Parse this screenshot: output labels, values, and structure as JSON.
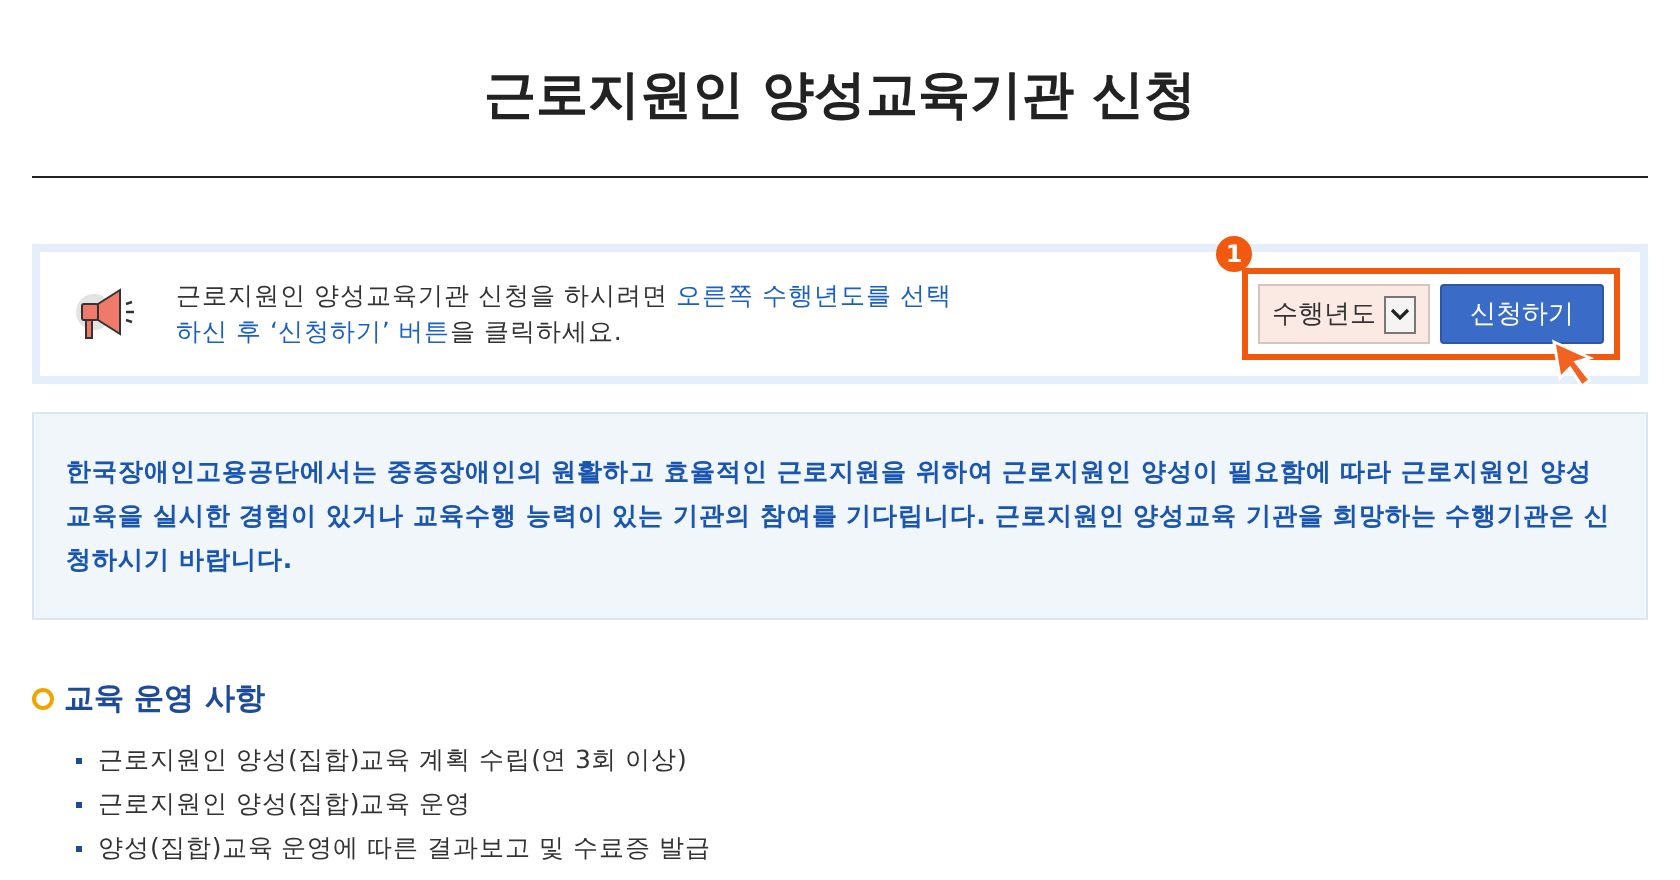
{
  "title": "근로지원인 양성교육기관 신청",
  "notice": {
    "text": "근로지원인 양성교육기관 신청을 하시려면 ",
    "link_text": "오른쪽 수행년도를 선택하신 후 ‘신청하기’ 버튼",
    "after": "을 클릭하세요."
  },
  "callout": {
    "number": "1"
  },
  "year_select": {
    "value": "수행년도"
  },
  "apply_button": "신청하기",
  "intro": "한국장애인고용공단에서는 중증장애인의 원활하고 효율적인 근로지원을 위하여 근로지원인 양성이 필요함에 따라 근로지원인 양성교육을 실시한 경험이 있거나 교육수행 능력이 있는 기관의 참여를 기다립니다. 근로지원인 양성교육 기관을 희망하는 수행기관은 신청하시기 바랍니다.",
  "section": {
    "heading": "교육 운영 사항",
    "items": [
      "근로지원인 양성(집합)교육 계획 수립(연 3회 이상)",
      "근로지원인 양성(집합)교육 운영",
      "양성(집합)교육 운영에 따른 결과보고 및 수료증 발급"
    ]
  }
}
